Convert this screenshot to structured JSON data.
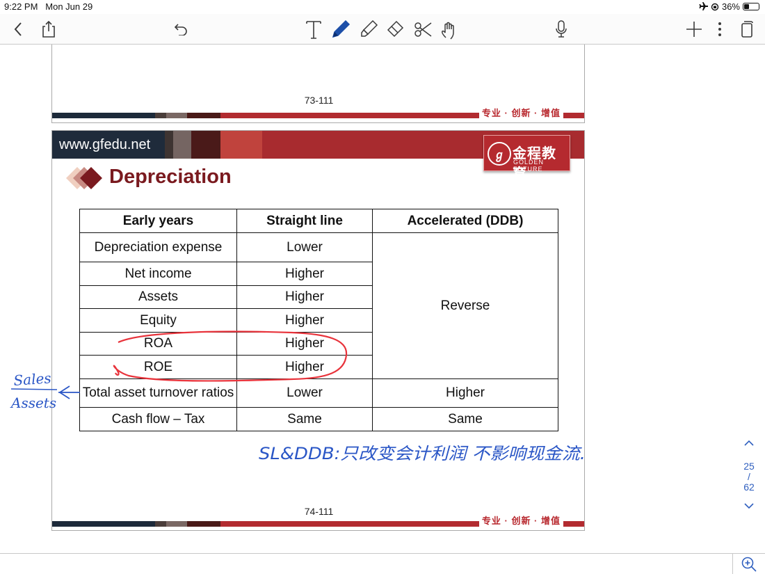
{
  "status": {
    "time": "9:22 PM",
    "date": "Mon Jun 29",
    "battery": "36%",
    "battery_level": 0.36
  },
  "toolbar": {
    "left": [
      "back-icon",
      "share-icon",
      "undo-icon"
    ],
    "tools": [
      "text-tool-icon",
      "pen-tool-icon",
      "highlighter-tool-icon",
      "eraser-tool-icon",
      "lasso-tool-icon",
      "touch-tool-icon"
    ],
    "right": [
      "microphone-icon",
      "add-icon",
      "more-icon",
      "pages-icon"
    ],
    "accent": "#1d4fa8"
  },
  "pages": [
    {
      "number": "73-111",
      "slogan": "专业 · 创新 · 增值"
    },
    {
      "number": "74-111",
      "slogan": "专业 · 创新 · 增值",
      "site": "www.gfedu.net",
      "logo_cn": "金程教育",
      "logo_en": "GOLDEN FUTURE",
      "title": "Depreciation",
      "table": {
        "headers": [
          "Early years",
          "Straight line",
          "Accelerated (DDB)"
        ],
        "rows": [
          [
            "Depreciation expense",
            "Lower"
          ],
          [
            "Net income",
            "Higher"
          ],
          [
            "Assets",
            "Higher"
          ],
          [
            "Equity",
            "Higher"
          ],
          [
            "ROA",
            "Higher"
          ],
          [
            "ROE",
            "Higher"
          ],
          [
            "Total asset turnover ratios",
            "Lower",
            "Higher"
          ],
          [
            "Cash flow – Tax",
            "Same",
            "Same"
          ]
        ],
        "merged_label": "Reverse"
      }
    }
  ],
  "annotations": {
    "fraction_top": "Sales",
    "fraction_bottom": "Assets",
    "note": "SL&DDB:只改变会计利润 不影响现金流."
  },
  "pager": {
    "current": "25",
    "sep": "/",
    "total": "62"
  },
  "colors": {
    "brand_red": "#a82b2f",
    "ink_red": "#e8333b",
    "ink_blue": "#2a56c6"
  }
}
